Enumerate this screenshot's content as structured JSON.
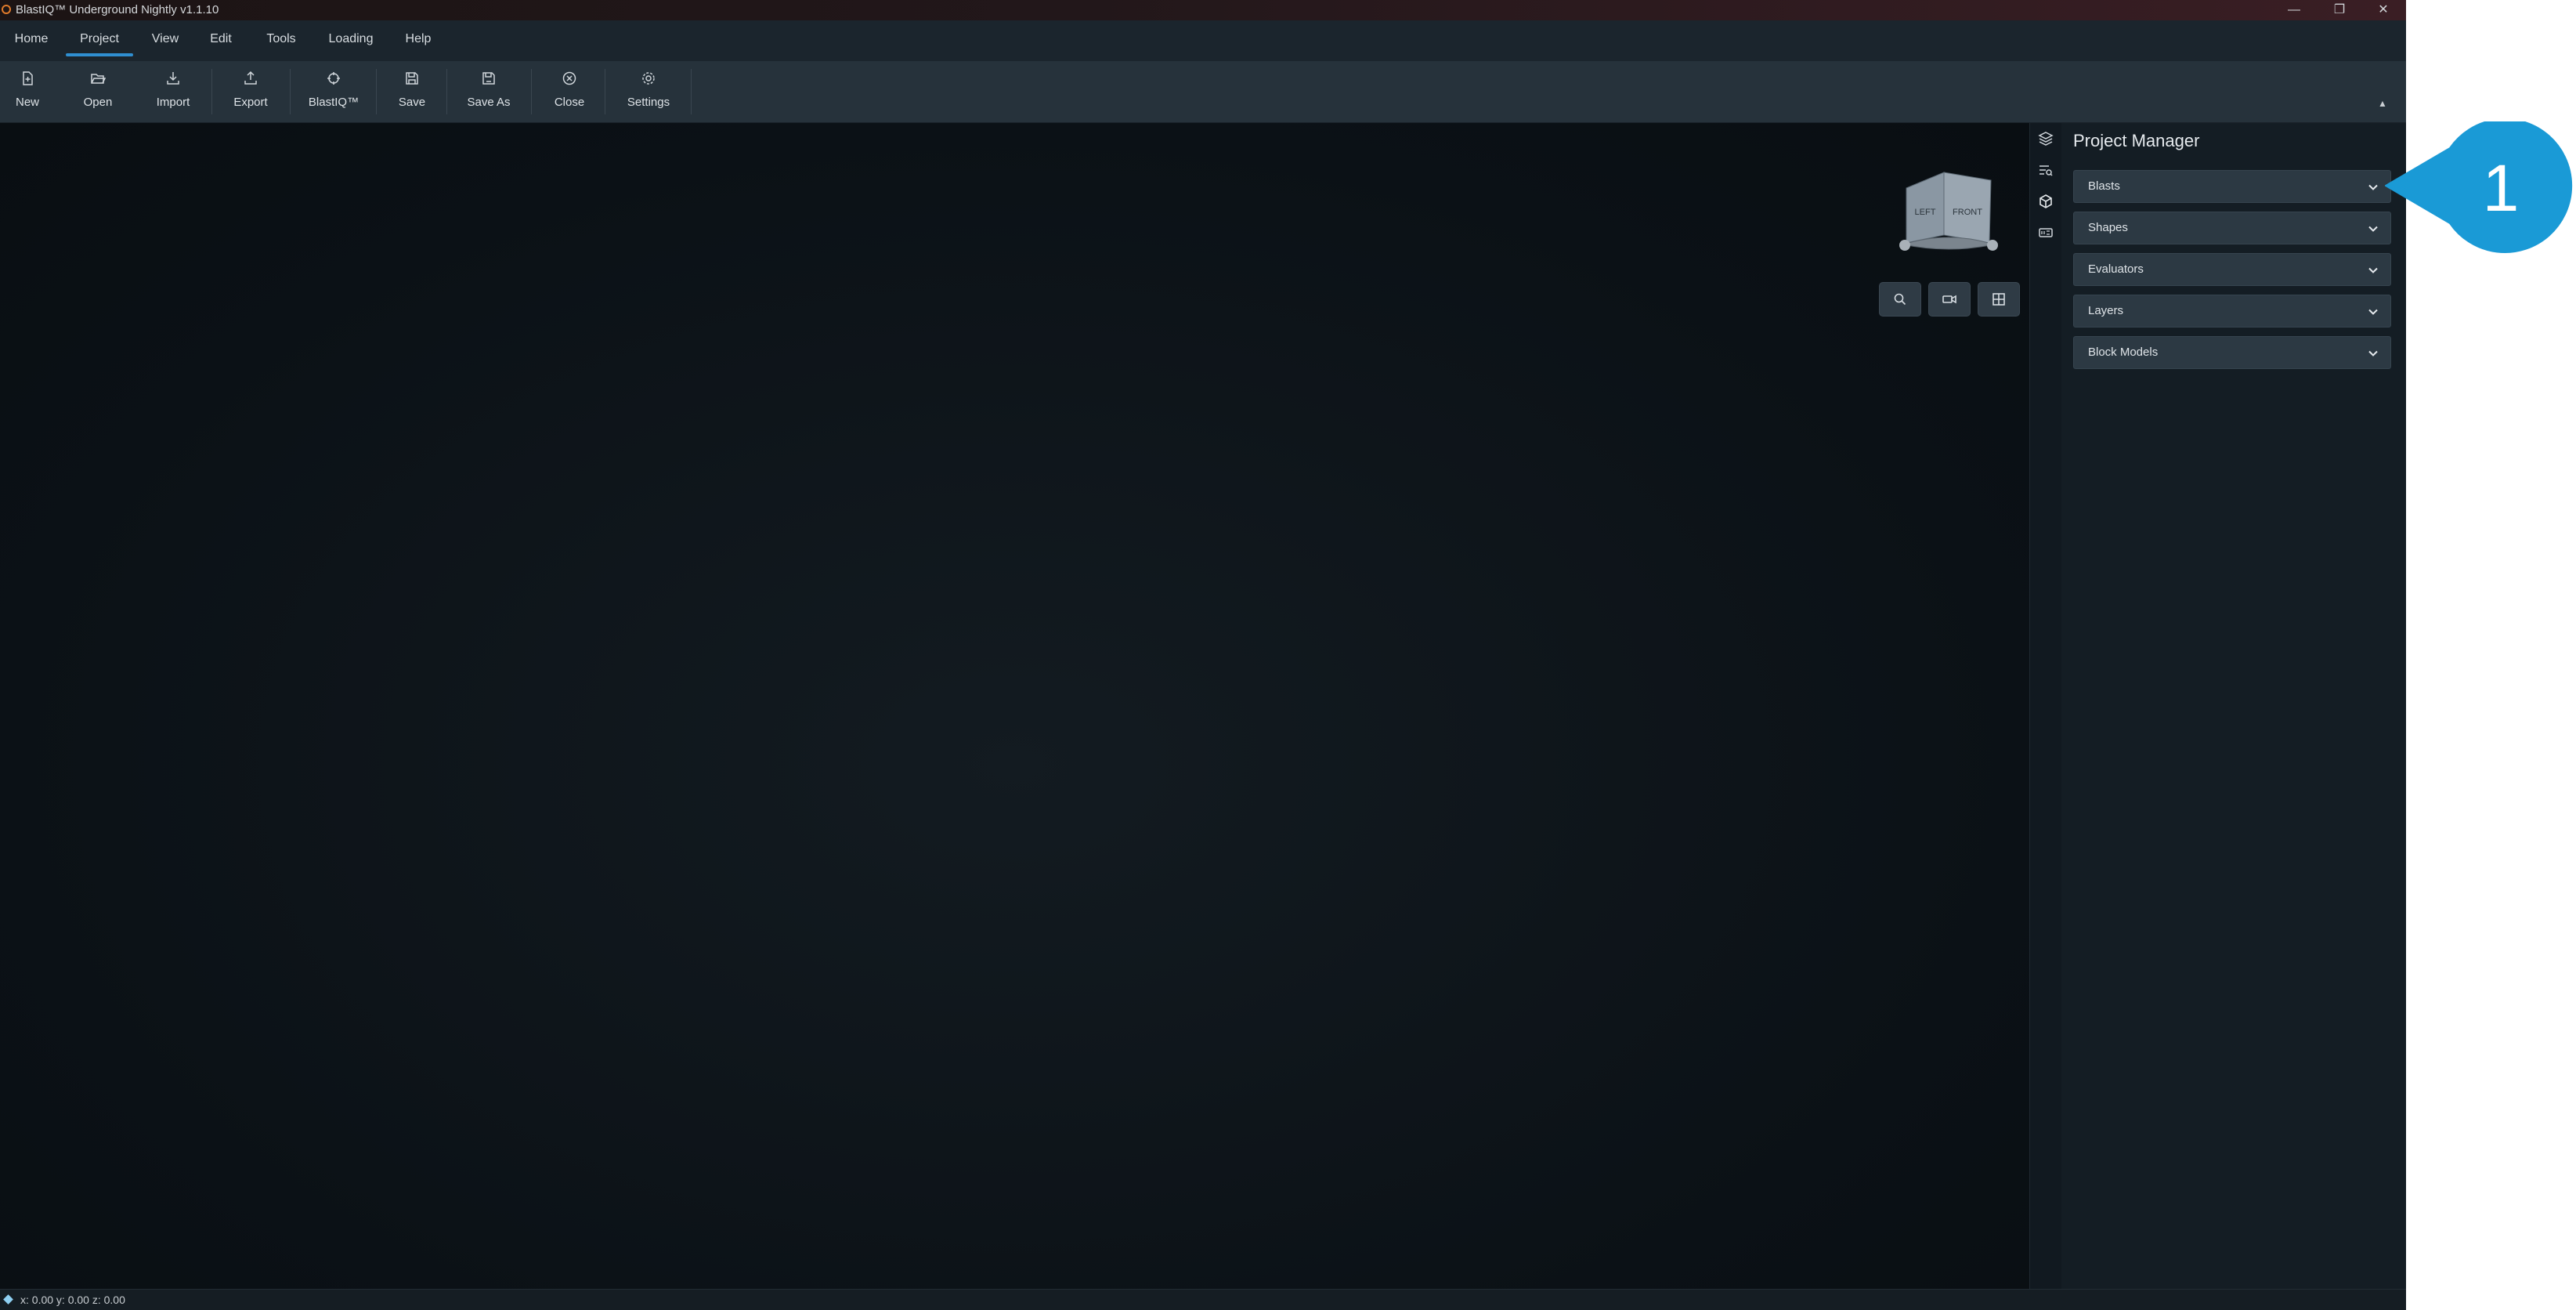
{
  "window": {
    "title": "BlastIQ™ Underground Nightly v1.1.10",
    "controls": {
      "minimize": "—",
      "restore": "❐",
      "close": "✕"
    }
  },
  "menu": {
    "items": [
      {
        "label": "Home"
      },
      {
        "label": "Project",
        "active": true
      },
      {
        "label": "View"
      },
      {
        "label": "Edit"
      },
      {
        "label": "Tools"
      },
      {
        "label": "Loading"
      },
      {
        "label": "Help"
      }
    ]
  },
  "ribbon": {
    "buttons": [
      {
        "label": "New",
        "icon": "new-file-icon"
      },
      {
        "label": "Open",
        "icon": "folder-open-icon"
      },
      {
        "label": "Import",
        "icon": "import-icon"
      },
      {
        "label": "Export",
        "icon": "export-icon"
      },
      {
        "label": "BlastIQ™",
        "icon": "blastiq-icon"
      },
      {
        "label": "Save",
        "icon": "save-icon"
      },
      {
        "label": "Save As",
        "icon": "save-as-icon"
      },
      {
        "label": "Close",
        "icon": "close-circle-icon"
      },
      {
        "label": "Settings",
        "icon": "gear-icon"
      }
    ],
    "collapse_glyph": "▲"
  },
  "viewport": {
    "cube": {
      "left_face": "LEFT",
      "front_face": "FRONT"
    },
    "tools": [
      {
        "icon": "zoom-icon"
      },
      {
        "icon": "camera-icon"
      },
      {
        "icon": "grid-icon"
      }
    ]
  },
  "side_icons": [
    "layers-icon",
    "list-search-icon",
    "cube-icon",
    "badge-icon"
  ],
  "project_manager": {
    "title": "Project Manager",
    "sections": [
      {
        "label": "Blasts"
      },
      {
        "label": "Shapes"
      },
      {
        "label": "Evaluators"
      },
      {
        "label": "Layers"
      },
      {
        "label": "Block Models"
      }
    ]
  },
  "status": {
    "coords": "x: 0.00 y: 0.00 z: 0.00"
  },
  "callout": {
    "number": "1",
    "color": "#1a9ad6"
  },
  "colors": {
    "accent": "#2f8fd1",
    "viewport_bg": "#0c1217",
    "panel_bg": "#141d24",
    "ribbon_bg": "#26323b",
    "menubar_bg": "#1b252d"
  }
}
